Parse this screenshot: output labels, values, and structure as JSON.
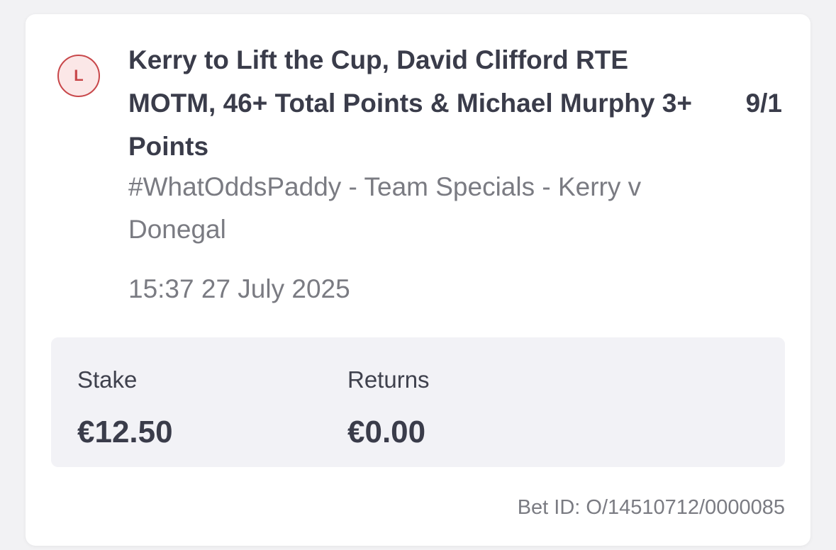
{
  "bet": {
    "status_letter": "L",
    "selection": "Kerry to Lift the Cup, David Clifford RTE MOTM, 46+ Total Points & Michael Murphy 3+ Points",
    "odds": "9/1",
    "market": "#WhatOddsPaddy - Team Specials - Kerry v Donegal",
    "timestamp": "15:37 27 July 2025",
    "stake_label": "Stake",
    "stake_value": "€12.50",
    "returns_label": "Returns",
    "returns_value": "€0.00",
    "bet_id": "Bet ID: O/14510712/0000085"
  },
  "colors": {
    "status_lost": "#c8474a",
    "status_lost_bg": "#fbe7e7",
    "primary_text": "#3a3c4a",
    "secondary_text": "#7a7b82",
    "summary_bg": "#f2f2f6"
  }
}
